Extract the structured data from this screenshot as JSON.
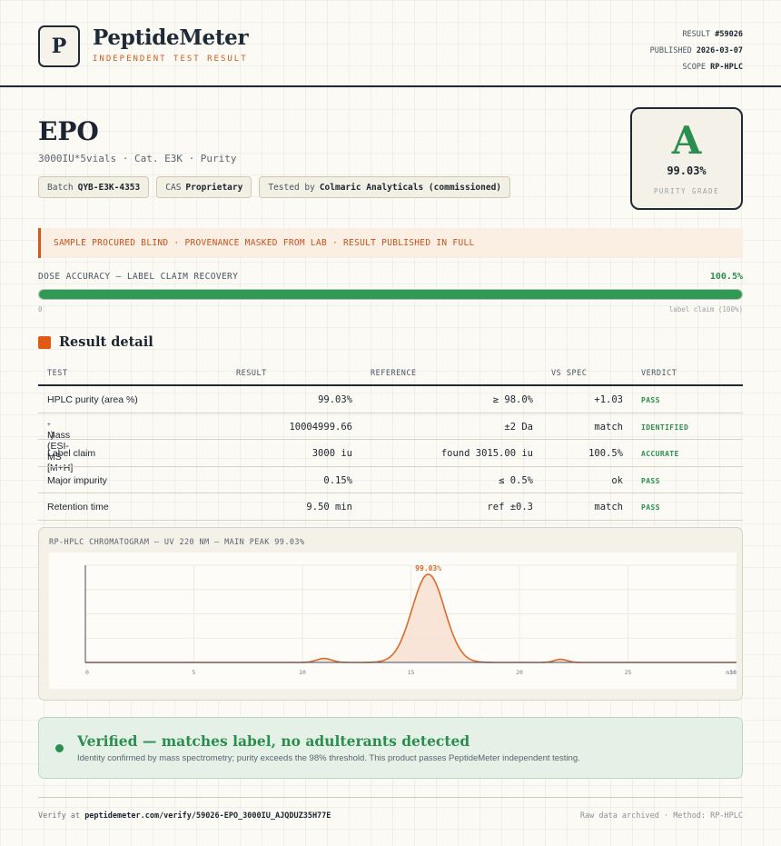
{
  "header": {
    "logo_letter": "P",
    "brand": "PeptideMeter",
    "tagline": "INDEPENDENT TEST RESULT",
    "result_label": "RESULT",
    "result_value": "#59026",
    "published_label": "PUBLISHED",
    "published_value": "2026-03-07",
    "scope_label": "SCOPE",
    "scope_value": "RP-HPLC"
  },
  "product": {
    "name": "EPO",
    "subtitle": "3000IU*5vials · Cat. E3K · Purity",
    "batch_label": "Batch",
    "batch_value": "QYB-E3K-4353",
    "cas_label": "CAS",
    "cas_value": "Proprietary",
    "tested_label": "Tested by",
    "tested_value": "Colmaric Analyticals (commissioned)"
  },
  "grade": {
    "letter": "A",
    "value": "99.03%",
    "label": "PURITY GRADE"
  },
  "notice": "SAMPLE PROCURED BLIND · PROVENANCE MASKED FROM LAB · RESULT PUBLISHED IN FULL",
  "dose": {
    "label": "DOSE ACCURACY — LABEL CLAIM RECOVERY",
    "value_text": "100.5%",
    "fill_fraction": 1.0,
    "min_label": "0",
    "max_label": "label claim (100%)"
  },
  "section_title": "Result detail",
  "table": {
    "headers": [
      "TEST",
      "RESULT",
      "REFERENCE",
      "VS SPEC",
      "VERDICT"
    ],
    "rows": [
      {
        "test": "HPLC purity (area %)",
        "result": "99.03%",
        "reference": "≥ 98.0%",
        "vs_spec": "+1.03",
        "verdict": "PASS"
      },
      {
        "test": "Mass (ESI-MS [M+H]",
        "test_sup": "+",
        "test_tail": ")",
        "result": "10004999.66",
        "reference": "±2 Da",
        "vs_spec": "match",
        "verdict": "IDENTIFIED"
      },
      {
        "test": "Label claim",
        "result": "3000 iu",
        "reference": "found 3015.00 iu",
        "vs_spec": "100.5%",
        "verdict": "ACCURATE"
      },
      {
        "test": "Major impurity",
        "result": "0.15%",
        "reference": "≤ 0.5%",
        "vs_spec": "ok",
        "verdict": "PASS"
      },
      {
        "test": "Retention time",
        "result": "9.50 min",
        "reference": "ref ±0.3",
        "vs_spec": "match",
        "verdict": "PASS"
      }
    ]
  },
  "chart_data": {
    "type": "line",
    "title": "RP-HPLC CHROMATOGRAM — UV 220 NM — MAIN PEAK 99.03%",
    "xlabel": "",
    "ylabel": "",
    "x_ticks": [
      "0",
      "5",
      "10",
      "15",
      "20",
      "25",
      "30"
    ],
    "x_end_label": "min",
    "xlim": [
      0,
      30
    ],
    "ylim": [
      0,
      100
    ],
    "peaks": [
      {
        "center": 11.0,
        "height": 4.5,
        "width": 0.35
      },
      {
        "center": 15.8,
        "height": 100,
        "width": 0.75
      },
      {
        "center": 21.9,
        "height": 3.5,
        "width": 0.3
      }
    ],
    "baseline": 0,
    "peak_label": "99.03%",
    "peak_label_x": 15.8,
    "line_color": "#d96b2c",
    "fill_color": "#f7e1d1"
  },
  "verified": {
    "title": "Verified — matches label, no adulterants detected",
    "text": "Identity confirmed by mass spectrometry; purity exceeds the 98% threshold. This product passes PeptideMeter independent testing."
  },
  "footer": {
    "verify_prefix": "Verify at",
    "verify_url": "peptidemeter.com/verify/59026-EPO_3000IU_AJQDUZ35H77E",
    "right_text": "Raw data archived · Method: RP-HPLC"
  }
}
